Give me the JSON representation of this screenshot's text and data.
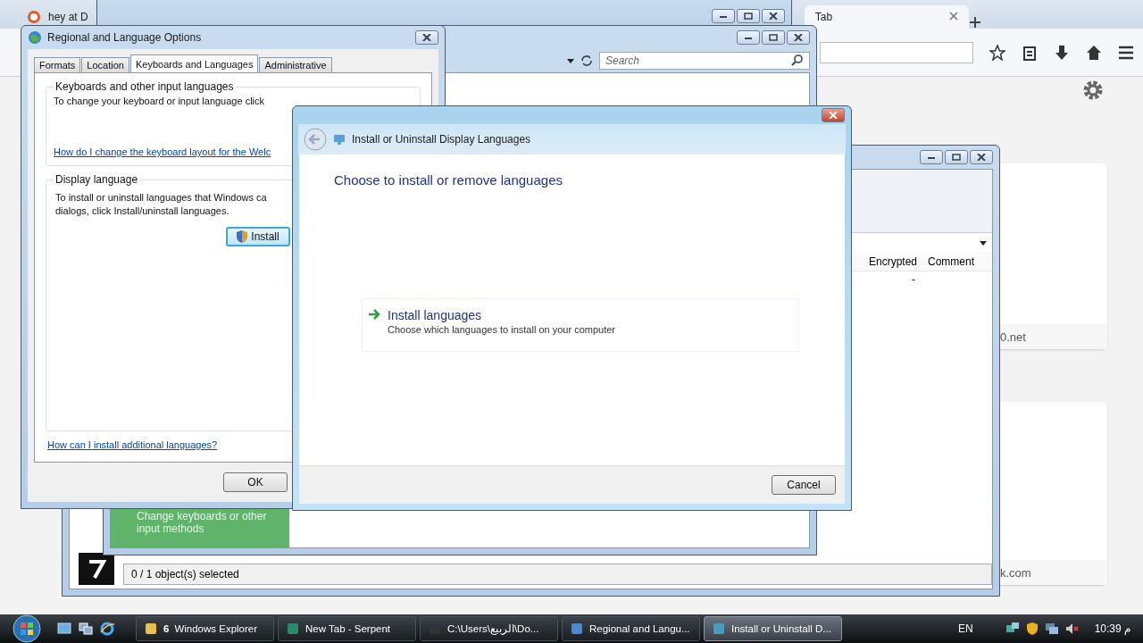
{
  "browser": {
    "tabs": [
      {
        "label": "hey at D",
        "selected": false
      },
      {
        "label": "Tab",
        "selected": true
      }
    ],
    "site_cards": [
      "0.net",
      "k.com"
    ]
  },
  "control_panel_window": {
    "search": {
      "placeholder": "Search"
    },
    "task_panel": "Change keyboards or other input methods"
  },
  "archive_window": {
    "columns": [
      "Encrypted",
      "Comment"
    ],
    "rows": [
      [
        "-"
      ]
    ],
    "status_bar": "0 / 1 object(s) selected"
  },
  "regional_dialog": {
    "title": "Regional and Language Options",
    "tabs": [
      {
        "label": "Formats",
        "selected": false
      },
      {
        "label": "Location",
        "selected": false
      },
      {
        "label": "Keyboards and Languages",
        "selected": true
      },
      {
        "label": "Administrative",
        "selected": false
      }
    ],
    "keyboards_group": {
      "title": "Keyboards and other input languages",
      "text": "To change your keyboard or input language click",
      "link": "How do I change the keyboard layout for the Welc"
    },
    "display_group": {
      "title": "Display language",
      "lines": [
        "To install or uninstall languages that Windows ca",
        "dialogs, click Install/uninstall languages."
      ],
      "button": "Install"
    },
    "link": "How can I install additional languages?",
    "ok_button": "OK"
  },
  "install_dialog": {
    "title": "Install or Uninstall Display Languages",
    "heading": "Choose to install or remove languages",
    "option": {
      "title": "Install languages",
      "description": "Choose which languages to install on your computer"
    },
    "cancel_button": "Cancel"
  },
  "taskbar": {
    "items": [
      {
        "count": "6",
        "label": "Windows Explorer",
        "selected": false
      },
      {
        "label": "New Tab - Serpent",
        "selected": false
      },
      {
        "label": "C:\\Users\\الربيع\\Do...",
        "selected": false
      },
      {
        "label": "Regional and Langu...",
        "selected": false
      },
      {
        "label": "Install or Uninstall D...",
        "selected": true
      }
    ],
    "language": "EN",
    "clock": "10:39 م"
  }
}
